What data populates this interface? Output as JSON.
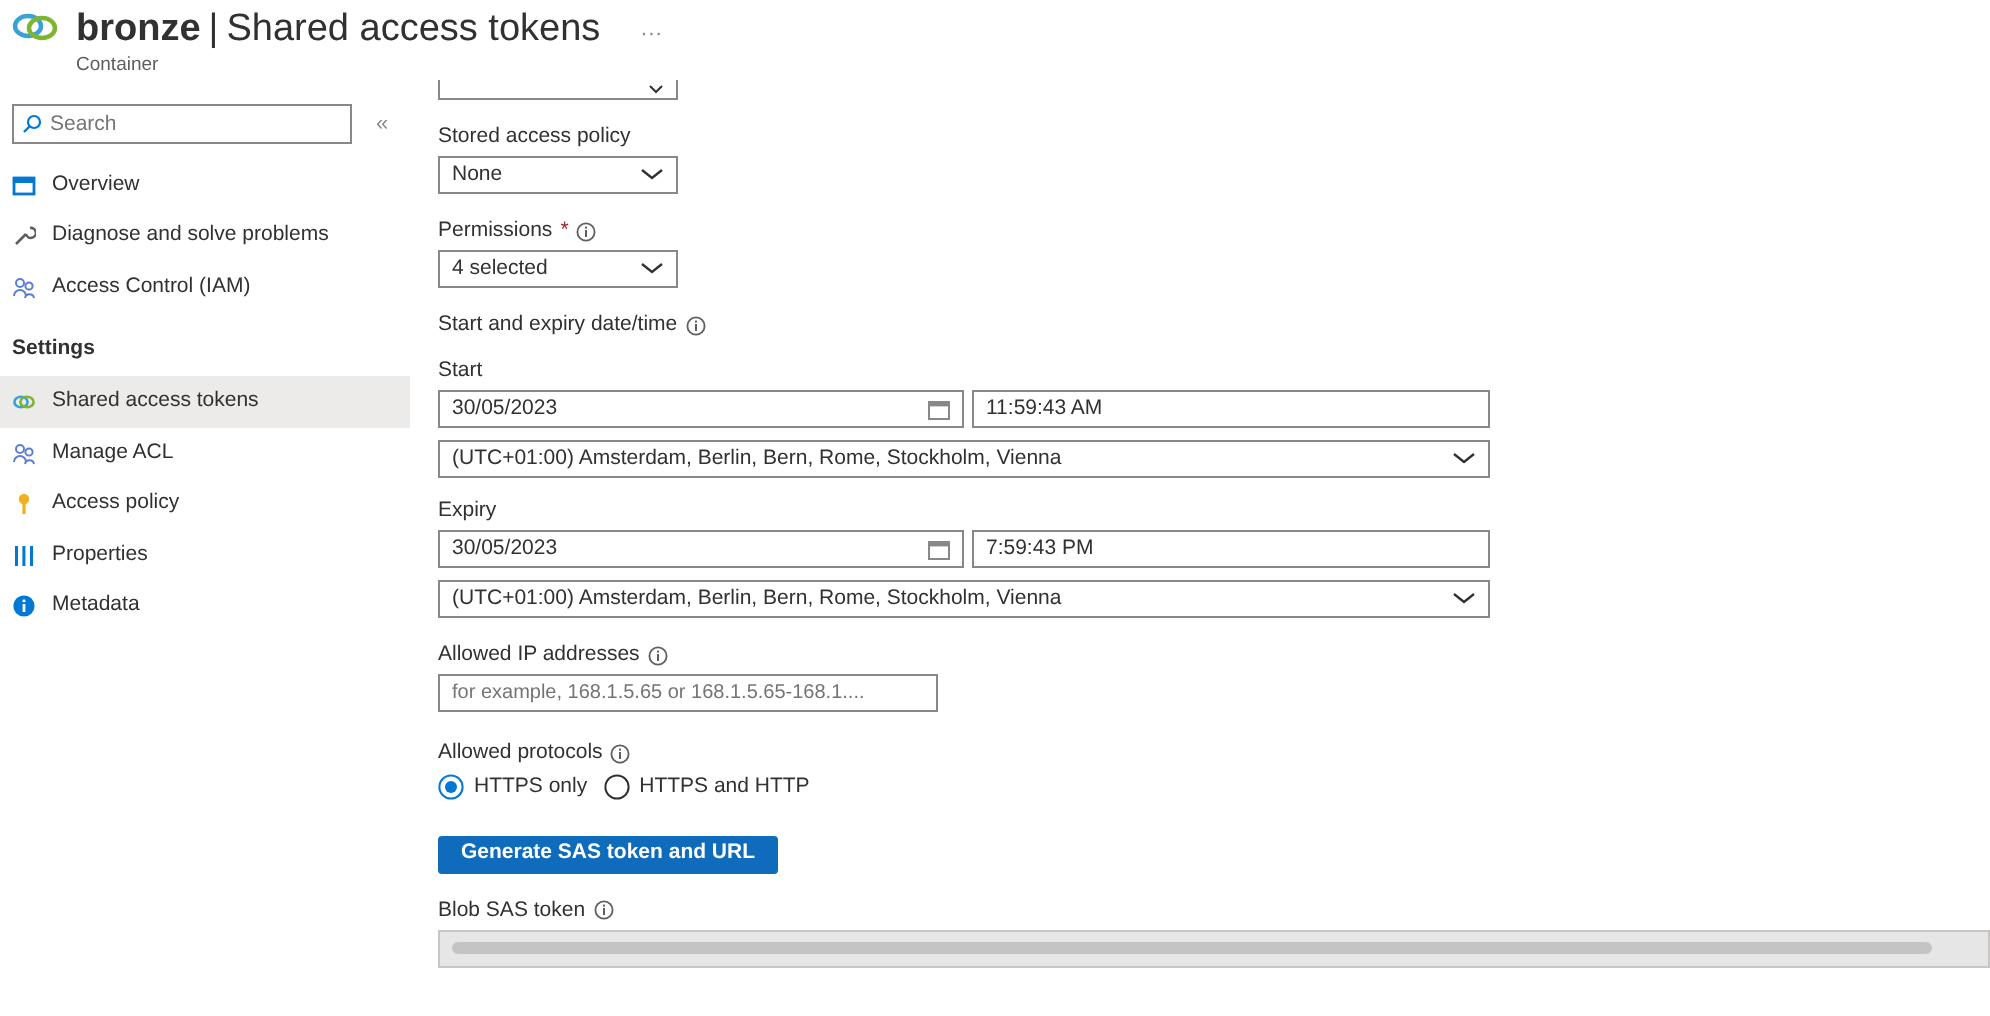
{
  "header": {
    "resource": "bronze",
    "separator": "|",
    "title": "Shared access tokens",
    "subtitle": "Container",
    "more": "···"
  },
  "sidebar": {
    "search": {
      "placeholder": "Search"
    },
    "collapse": "«",
    "items": [
      {
        "kind": "item",
        "label": "Overview",
        "selected": false
      },
      {
        "kind": "item",
        "label": "Diagnose and solve problems",
        "selected": false
      },
      {
        "kind": "item",
        "label": "Access Control (IAM)",
        "selected": false
      },
      {
        "kind": "header",
        "label": "Settings"
      },
      {
        "kind": "item",
        "label": "Shared access tokens",
        "selected": true
      },
      {
        "kind": "item",
        "label": "Manage ACL",
        "selected": false
      },
      {
        "kind": "item",
        "label": "Access policy",
        "selected": false
      },
      {
        "kind": "item",
        "label": "Properties",
        "selected": false
      },
      {
        "kind": "item",
        "label": "Metadata",
        "selected": false
      }
    ]
  },
  "form": {
    "stored_access_policy": {
      "label": "Stored access policy",
      "value": "None"
    },
    "permissions": {
      "label": "Permissions",
      "required_mark": "*",
      "value": "4 selected"
    },
    "date_section": "Start and expiry date/time",
    "start": {
      "label": "Start",
      "date": "30/05/2023",
      "time": "11:59:43 AM",
      "timezone": "(UTC+01:00) Amsterdam, Berlin, Bern, Rome, Stockholm, Vienna"
    },
    "expiry": {
      "label": "Expiry",
      "date": "30/05/2023",
      "time": "7:59:43 PM",
      "timezone": "(UTC+01:00) Amsterdam, Berlin, Bern, Rome, Stockholm, Vienna"
    },
    "allowed_ip": {
      "label": "Allowed IP addresses",
      "placeholder": "for example, 168.1.5.65 or 168.1.5.65-168.1...."
    },
    "protocols": {
      "label": "Allowed protocols",
      "options": [
        {
          "label": "HTTPS only",
          "selected": true
        },
        {
          "label": "HTTPS and HTTP",
          "selected": false
        }
      ]
    },
    "generate_button": "Generate SAS token and URL",
    "blob_sas_token": {
      "label": "Blob SAS token"
    }
  }
}
